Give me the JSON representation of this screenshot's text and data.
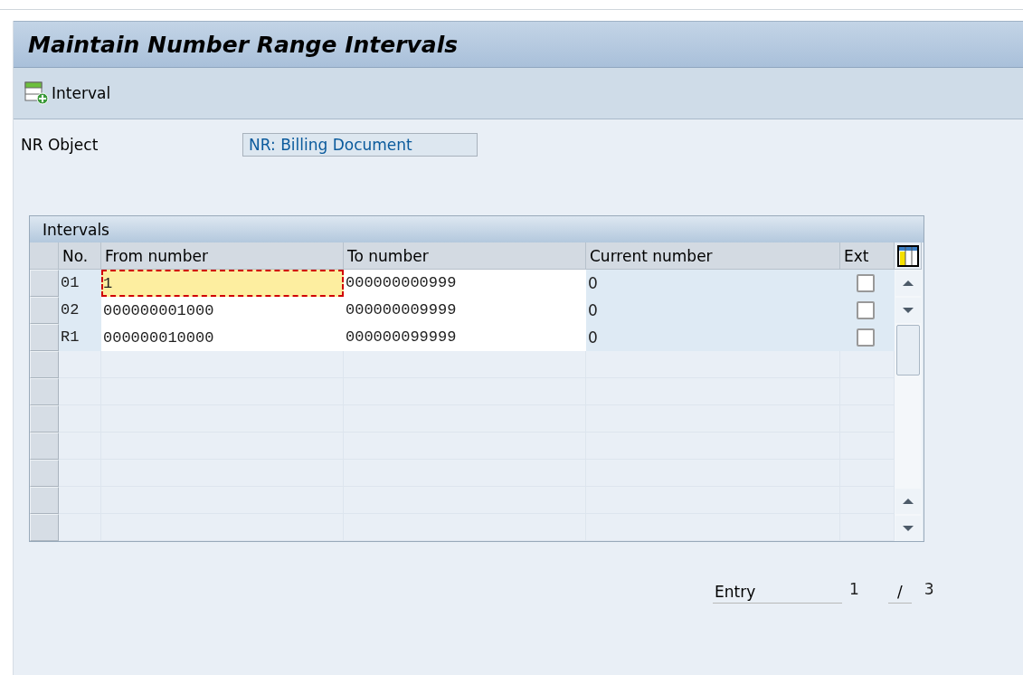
{
  "window": {
    "title": "Maintain Number Range Intervals"
  },
  "toolbar": {
    "buttons": [
      {
        "label": "Interval"
      }
    ]
  },
  "nr_object": {
    "label": "NR Object",
    "value": "NR: Billing Document"
  },
  "table": {
    "title": "Intervals",
    "columns": [
      "No.",
      "From number",
      "To number",
      "Current number",
      "Ext"
    ],
    "rows": [
      {
        "no": "01",
        "from": "1",
        "to": "000000000999",
        "current": "0",
        "ext": false,
        "focused": true
      },
      {
        "no": "02",
        "from": "000000001000",
        "to": "000000009999",
        "current": "0",
        "ext": false,
        "focused": false
      },
      {
        "no": "R1",
        "from": "000000010000",
        "to": "000000099999",
        "current": "0",
        "ext": false,
        "focused": false
      }
    ]
  },
  "entry": {
    "label": "Entry",
    "current": "1",
    "separator": "/",
    "total": "3"
  }
}
